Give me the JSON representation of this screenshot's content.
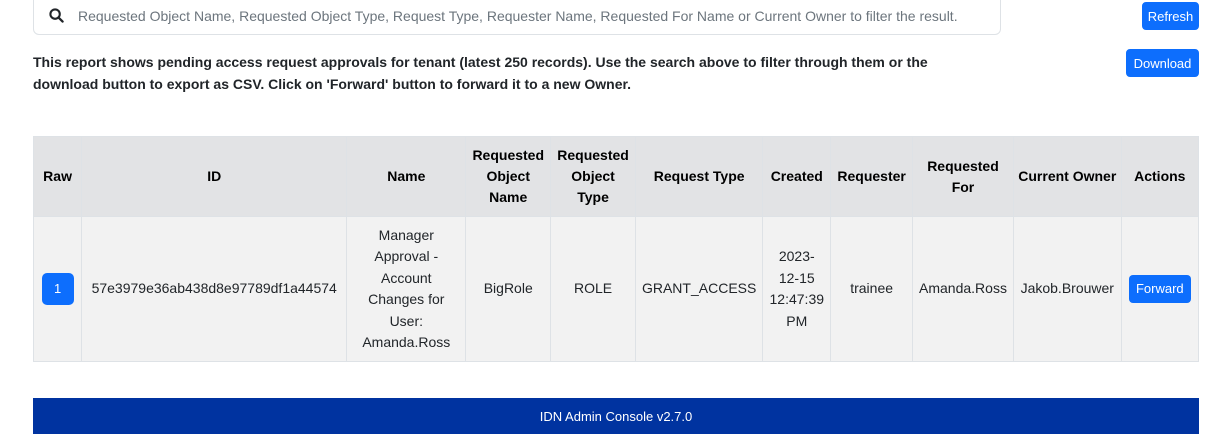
{
  "search": {
    "placeholder": "Requested Object Name, Requested Object Type, Request Type, Requester Name, Requested For Name or Current Owner to filter the result."
  },
  "toolbar": {
    "refresh_label": "Refresh",
    "download_label": "Download"
  },
  "description": "This report shows pending access request approvals for tenant (latest 250 records). Use the search above to filter through them or the download button to export as CSV. Click on 'Forward' button to forward it to a new Owner.",
  "table": {
    "headers": [
      "Raw",
      "ID",
      "Name",
      "Requested Object Name",
      "Requested Object Type",
      "Request Type",
      "Created",
      "Requester",
      "Requested For",
      "Current Owner",
      "Actions"
    ],
    "rows": [
      {
        "raw": "1",
        "id": "57e3979e36ab438d8e97789df1a44574",
        "name": "Manager Approval - Account Changes for User: Amanda.Ross",
        "requested_object_name": "BigRole",
        "requested_object_type": "ROLE",
        "request_type": "GRANT_ACCESS",
        "created": "2023-12-15 12:47:39 PM",
        "requester": "trainee",
        "requested_for": "Amanda.Ross",
        "current_owner": "Jakob.Brouwer",
        "action_label": "Forward"
      }
    ]
  },
  "footer": {
    "text": "IDN Admin Console v2.7.0"
  },
  "colors": {
    "primary": "#0d6efd",
    "footer_bg": "#0033a0",
    "header_bg": "#e2e3e5",
    "row_bg": "#f2f2f2"
  }
}
